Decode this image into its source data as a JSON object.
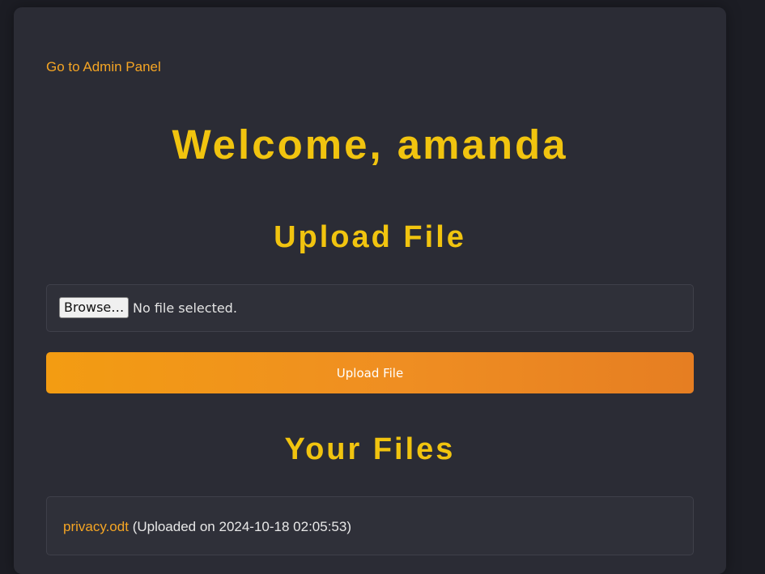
{
  "nav": {
    "admin_link": "Go to Admin Panel"
  },
  "header": {
    "welcome": "Welcome, amanda"
  },
  "upload": {
    "title": "Upload File",
    "browse_label": "Browse…",
    "no_file_text": "No file selected.",
    "submit_label": "Upload File"
  },
  "files": {
    "title": "Your Files",
    "items": [
      {
        "name": "privacy.odt",
        "uploaded": "(Uploaded on 2024-10-18 02:05:53)"
      }
    ]
  },
  "colors": {
    "accent": "#f1c40f",
    "link": "#f5a524",
    "button_gradient_start": "#f39c12",
    "button_gradient_end": "#e67e22",
    "card_bg": "#2b2c35",
    "page_bg": "#1c1d24"
  }
}
